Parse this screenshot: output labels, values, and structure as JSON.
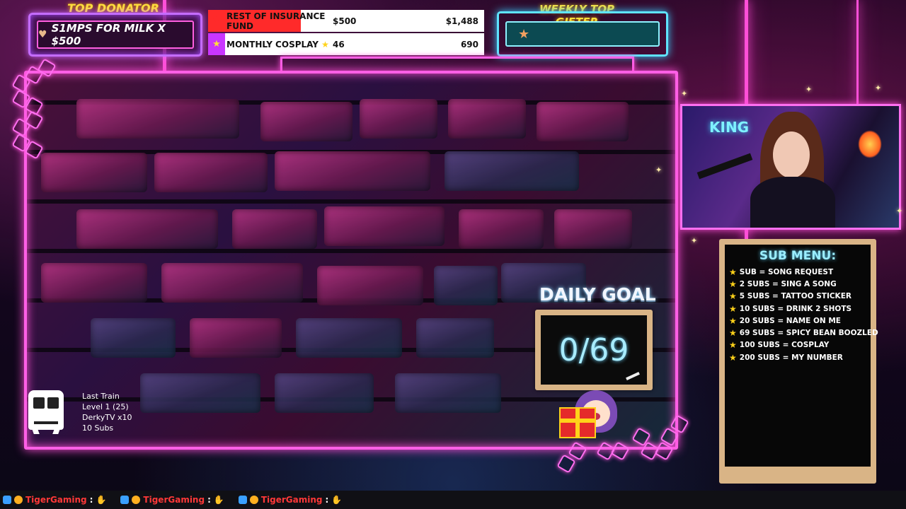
{
  "top_donator": {
    "label": "TOP DONATOR",
    "name": "S1MPS FOR MILK X $500",
    "icon": "heart-icon"
  },
  "goals": [
    {
      "name": "REST OF INSURANCE FUND",
      "current": "$500",
      "target": "$1,488",
      "progress": 0.336,
      "icon": "heart-icon",
      "fill_color": "#ff2a2a"
    },
    {
      "name": "MONTHLY COSPLAY",
      "current": "46",
      "target": "690",
      "progress": 0.067,
      "icon": "star-icon",
      "fill_color": "#c936ff"
    }
  ],
  "weekly_top_gifter": {
    "label": "WEEKLY TOP GIFTER",
    "icon": "star-icon"
  },
  "train": {
    "title": "Last Train",
    "level": "Level 1  (25)",
    "user": "DerkyTV x10",
    "subs": "10 Subs"
  },
  "daily_goal": {
    "label": "DAILY GOAL",
    "value": "0/69"
  },
  "webcam": {
    "sign_text": "KING"
  },
  "sub_menu": {
    "title": "SUB MENU:",
    "items": [
      "SUB = SONG REQUEST",
      "2 SUBS = SING A SONG",
      "5 SUBS = TATTOO STICKER",
      "10 SUBS = DRINK 2 SHOTS",
      "20 SUBS = NAME ON ME",
      "69 SUBS = SPICY BEAN BOOZLED",
      "100 SUBS = COSPLAY",
      "200 SUBS = MY NUMBER"
    ]
  },
  "ticker": {
    "entries": [
      {
        "name": "TigerGaming",
        "sep": ":"
      },
      {
        "name": "TigerGaming",
        "sep": ":"
      },
      {
        "name": "TigerGaming",
        "sep": ":"
      }
    ]
  },
  "colors": {
    "neon_pink": "#ff5fe6",
    "neon_cyan": "#5fe4ff",
    "gold": "#ffe03a"
  }
}
